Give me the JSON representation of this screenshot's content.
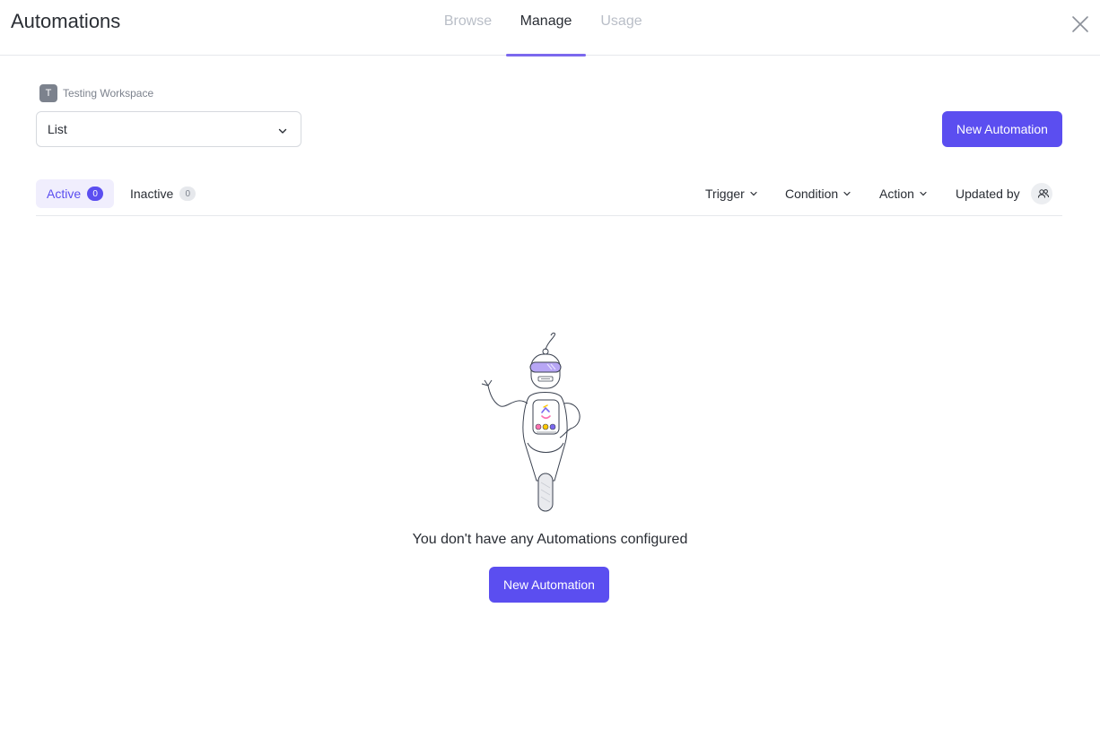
{
  "header": {
    "title": "Automations",
    "tabs": [
      {
        "label": "Browse",
        "active": false
      },
      {
        "label": "Manage",
        "active": true
      },
      {
        "label": "Usage",
        "active": false
      }
    ]
  },
  "workspace": {
    "initial": "T",
    "name": "Testing Workspace"
  },
  "location_select": {
    "value": "List"
  },
  "toolbar": {
    "new_automation_label": "New Automation"
  },
  "status_tabs": [
    {
      "label": "Active",
      "count": "0",
      "active": true
    },
    {
      "label": "Inactive",
      "count": "0",
      "active": false
    }
  ],
  "filters": {
    "trigger": "Trigger",
    "condition": "Condition",
    "action": "Action",
    "updated_by": "Updated by"
  },
  "empty_state": {
    "message": "You don't have any Automations configured",
    "button_label": "New Automation"
  },
  "colors": {
    "accent": "#5b4ef0",
    "tab_underline": "#7b68ee",
    "active_tab_bg": "#f0eefd"
  }
}
